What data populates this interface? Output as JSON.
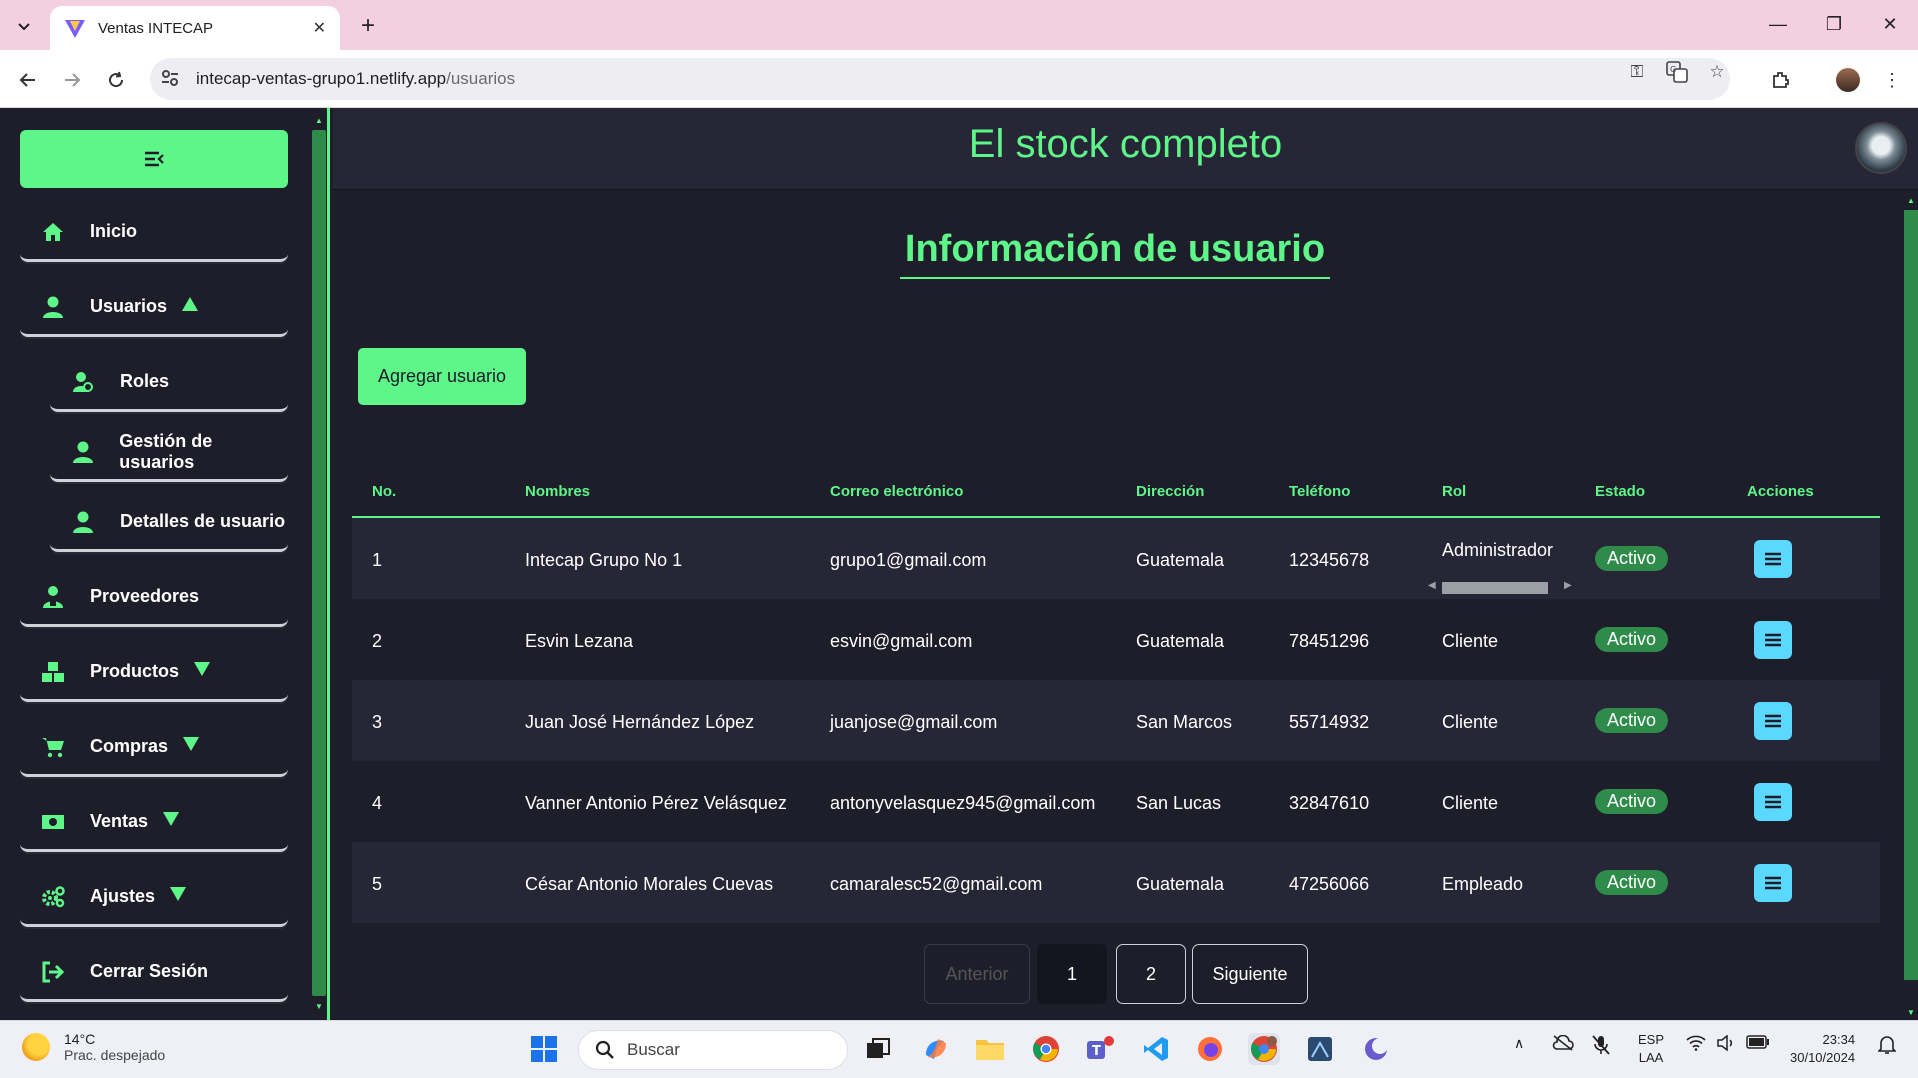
{
  "browser": {
    "tab_title": "Ventas INTECAP",
    "url_domain": "intecap-ventas-grupo1.netlify.app",
    "url_path": "/usuarios",
    "new_tab_symbol": "+"
  },
  "app": {
    "brand": "El stock completo",
    "accent_color": "#5ef589"
  },
  "sidebar": {
    "items": [
      {
        "label": "Inicio",
        "icon": "home-icon"
      },
      {
        "label": "Usuarios",
        "icon": "user-icon",
        "caret": "up"
      },
      {
        "label": "Roles",
        "icon": "roles-icon"
      },
      {
        "label": "Gestión de usuarios",
        "icon": "user-icon"
      },
      {
        "label": "Detalles de usuario",
        "icon": "user-icon"
      },
      {
        "label": "Proveedores",
        "icon": "supplier-icon"
      },
      {
        "label": "Productos",
        "icon": "boxes-icon",
        "caret": "down"
      },
      {
        "label": "Compras",
        "icon": "cart-icon",
        "caret": "down"
      },
      {
        "label": "Ventas",
        "icon": "money-icon",
        "caret": "down"
      },
      {
        "label": "Ajustes",
        "icon": "gears-icon",
        "caret": "down"
      },
      {
        "label": "Cerrar Sesión",
        "icon": "logout-icon"
      }
    ]
  },
  "main": {
    "title": "Información de usuario",
    "add_button": "Agregar usuario",
    "table": {
      "headers": [
        "No.",
        "Nombres",
        "Correo electrónico",
        "Dirección",
        "Teléfono",
        "Rol",
        "Estado",
        "Acciones"
      ],
      "rows": [
        {
          "no": "1",
          "nombre": "Intecap Grupo No 1",
          "correo": "grupo1@gmail.com",
          "direccion": "Guatemala",
          "telefono": "12345678",
          "rol": "Administrador",
          "estado": "Activo"
        },
        {
          "no": "2",
          "nombre": "Esvin Lezana",
          "correo": "esvin@gmail.com",
          "direccion": "Guatemala",
          "telefono": "78451296",
          "rol": "Cliente",
          "estado": "Activo"
        },
        {
          "no": "3",
          "nombre": "Juan José Hernández López",
          "correo": "juanjose@gmail.com",
          "direccion": "San Marcos",
          "telefono": "55714932",
          "rol": "Cliente",
          "estado": "Activo"
        },
        {
          "no": "4",
          "nombre": "Vanner Antonio Pérez Velásquez",
          "correo": "antonyvelasquez945@gmail.com",
          "direccion": "San Lucas",
          "telefono": "32847610",
          "rol": "Cliente",
          "estado": "Activo"
        },
        {
          "no": "5",
          "nombre": "César Antonio Morales Cuevas",
          "correo": "camaralesc52@gmail.com",
          "direccion": "Guatemala",
          "telefono": "47256066",
          "rol": "Empleado",
          "estado": "Activo"
        }
      ]
    },
    "pagination": {
      "prev": "Anterior",
      "pages": [
        "1",
        "2"
      ],
      "current": "1",
      "next": "Siguiente"
    }
  },
  "taskbar": {
    "weather_temp": "14°C",
    "weather_desc": "Prac. despejado",
    "search_placeholder": "Buscar",
    "lang_line1": "ESP",
    "lang_line2": "LAA",
    "time": "23:34",
    "date": "30/10/2024"
  }
}
